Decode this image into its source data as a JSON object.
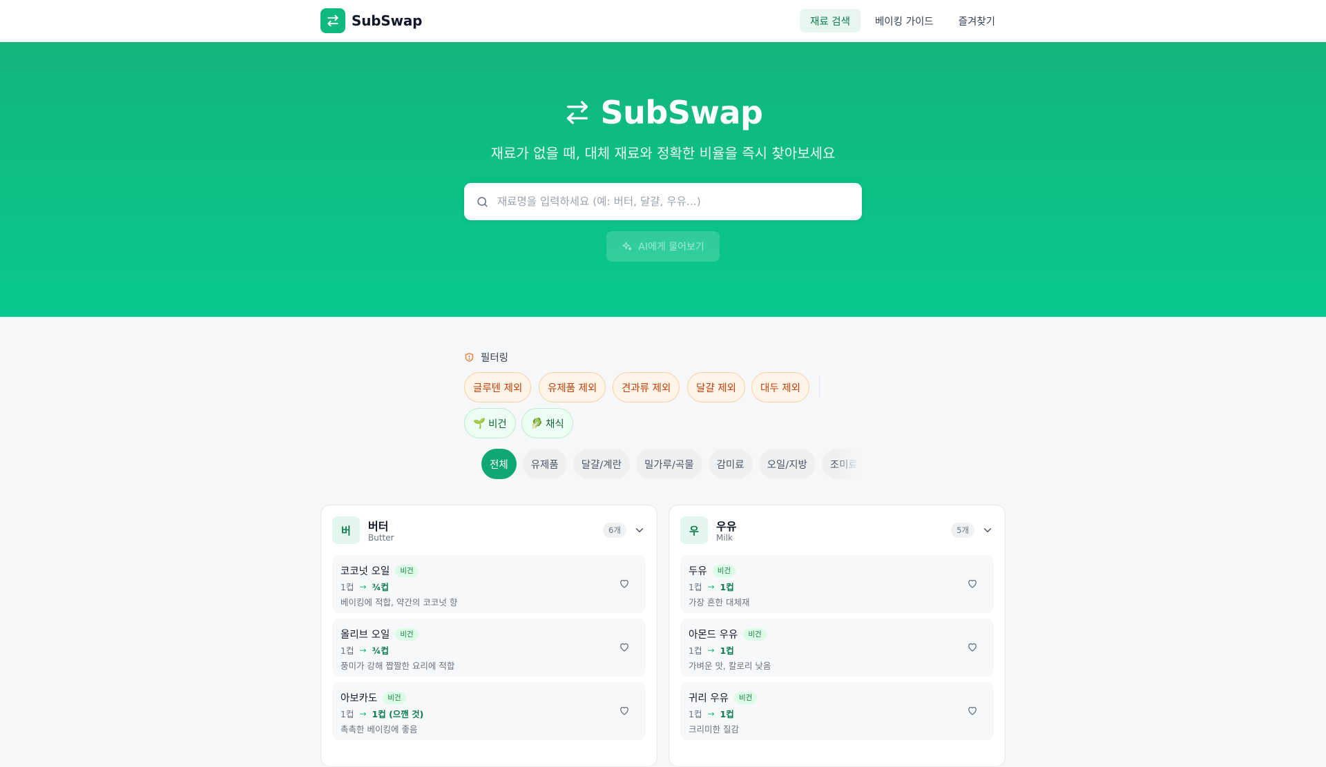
{
  "nav": {
    "brand": "SubSwap",
    "links": [
      {
        "label": "재료 검색",
        "active": true
      },
      {
        "label": "베이킹 가이드",
        "active": false
      },
      {
        "label": "즐겨찾기",
        "active": false
      }
    ]
  },
  "hero": {
    "title": "SubSwap",
    "subtitle": "재료가 없을 때, 대체 재료와 정확한 비율을 즉시 찾아보세요",
    "search_placeholder": "재료명을 입력하세요 (예: 버터, 달걀, 우유...)",
    "search_value": "",
    "ai_button": "AI에게 물어보기"
  },
  "filters": {
    "heading": "필터링",
    "exclusions": [
      "글루텐 제외",
      "유제품 제외",
      "견과류 제외",
      "달걀 제외",
      "대두 제외"
    ],
    "diets": [
      {
        "icon": "🌱",
        "label": "비건"
      },
      {
        "icon": "🥬",
        "label": "채식"
      }
    ]
  },
  "categories": [
    "전체",
    "유제품",
    "달걀/계란",
    "밀가루/곡물",
    "감미료",
    "오일/지방",
    "조미료"
  ],
  "cards": [
    {
      "initial": "버",
      "title": "버터",
      "subtitle": "Butter",
      "count": "6개",
      "items": [
        {
          "name": "코코넛 오일",
          "tag": "비건",
          "from": "1컵",
          "to": "¾컵",
          "desc": "베이킹에 적합, 약간의 코코넛 향"
        },
        {
          "name": "올리브 오일",
          "tag": "비건",
          "from": "1컵",
          "to": "¾컵",
          "desc": "풍미가 강해 짭짤한 요리에 적합"
        },
        {
          "name": "아보카도",
          "tag": "비건",
          "from": "1컵",
          "to": "1컵 (으깬 것)",
          "desc": "촉촉한 베이킹에 좋음"
        }
      ]
    },
    {
      "initial": "우",
      "title": "우유",
      "subtitle": "Milk",
      "count": "5개",
      "items": [
        {
          "name": "두유",
          "tag": "비건",
          "from": "1컵",
          "to": "1컵",
          "desc": "가장 흔한 대체재"
        },
        {
          "name": "아몬드 우유",
          "tag": "비건",
          "from": "1컵",
          "to": "1컵",
          "desc": "가벼운 맛, 칼로리 낮음"
        },
        {
          "name": "귀리 우유",
          "tag": "비건",
          "from": "1컵",
          "to": "1컵",
          "desc": "크리미한 질감"
        }
      ]
    }
  ]
}
